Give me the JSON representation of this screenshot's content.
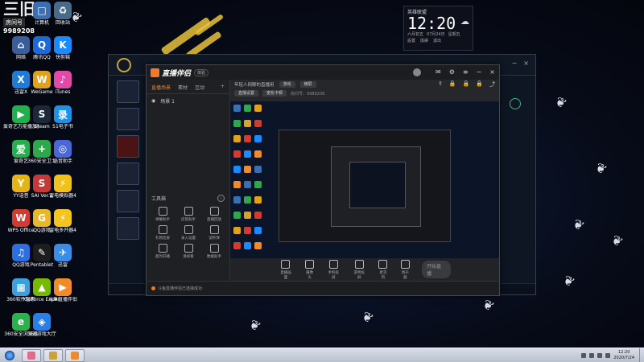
{
  "desktop": {
    "room_widget": {
      "big": "三旧",
      "label": "房间号",
      "number": "9989208"
    },
    "icons": [
      {
        "id": "computer",
        "label": "计算机",
        "color": "#3b6fb0",
        "glyph": "□"
      },
      {
        "id": "recycle",
        "label": "回收站",
        "color": "#4a6a8a",
        "glyph": "♻"
      },
      {
        "id": "network",
        "label": "网络",
        "color": "#3a5e9a",
        "glyph": "⌂"
      },
      {
        "id": "qq",
        "label": "腾讯QQ",
        "color": "#1a6bd8",
        "glyph": "Q"
      },
      {
        "id": "kuaitui",
        "label": "快剪辑",
        "color": "#1a8aff",
        "glyph": "K"
      },
      {
        "id": "xunlei",
        "label": "迅雷X",
        "color": "#1c7cd6",
        "glyph": "X"
      },
      {
        "id": "wegame",
        "label": "WeGame",
        "color": "#e0a21a",
        "glyph": "W"
      },
      {
        "id": "itunes",
        "label": "iTunes",
        "color": "#e24aa8",
        "glyph": "♪"
      },
      {
        "id": "aiqiyi",
        "label": "爱奇艺万能播放器",
        "color": "#21b04b",
        "glyph": "▶"
      },
      {
        "id": "steam",
        "label": "Steam",
        "color": "#1b2838",
        "glyph": "S"
      },
      {
        "id": "luyin",
        "label": "51电子书",
        "color": "#1e90e8",
        "glyph": "录"
      },
      {
        "id": "iqiyi",
        "label": "爱奇艺",
        "color": "#23b14d",
        "glyph": "爱"
      },
      {
        "id": "360",
        "label": "360安全卫士",
        "color": "#2ea84a",
        "glyph": "+"
      },
      {
        "id": "chat",
        "label": "语音助手",
        "color": "#4a67d8",
        "glyph": "◎"
      },
      {
        "id": "yy",
        "label": "YY语音",
        "color": "#e4b317",
        "glyph": "Y"
      },
      {
        "id": "sai",
        "label": "SAI Ver.2",
        "color": "#c23a3a",
        "glyph": "S"
      },
      {
        "id": "zbj4",
        "label": "雷电模拟器4",
        "color": "#f1c21b",
        "glyph": "⚡"
      },
      {
        "id": "wps",
        "label": "WPS Office",
        "color": "#d23b2e",
        "glyph": "W"
      },
      {
        "id": "qqgame",
        "label": "QQ游戏",
        "color": "#e9b82a",
        "glyph": "G"
      },
      {
        "id": "leidian",
        "label": "雷电多开器4",
        "color": "#f4c41f",
        "glyph": "⚡"
      },
      {
        "id": "qqmusic",
        "label": "QQ游戏",
        "color": "#2b6fe0",
        "glyph": "♫"
      },
      {
        "id": "pentablet",
        "label": "Pentablet",
        "color": "#1d1d1d",
        "glyph": "✎"
      },
      {
        "id": "feishu",
        "label": "迅雷",
        "color": "#3a8ce8",
        "glyph": "✈"
      },
      {
        "id": "360soft",
        "label": "360软件管家",
        "color": "#3aa0e0",
        "glyph": "▦"
      },
      {
        "id": "geforce",
        "label": "GeForce Experience",
        "color": "#76b900",
        "glyph": "▲"
      },
      {
        "id": "douyu",
        "label": "斗鱼直播伴侣",
        "color": "#f08a2a",
        "glyph": "▶"
      },
      {
        "id": "360browser",
        "label": "360安全浏览器",
        "color": "#2bb24c",
        "glyph": "e"
      },
      {
        "id": "360zip",
        "label": "360游戏大厅",
        "color": "#2a7ee4",
        "glyph": "◈"
      }
    ],
    "clock": {
      "location": "英雄联盟",
      "time": "12:20",
      "date_cn": "六月初五",
      "date": "07月24日",
      "weekday": "星期五",
      "foot": [
        "設置",
        "換膚",
        "退出"
      ]
    }
  },
  "app": {
    "logo_text": "直播伴侣",
    "version": "体验",
    "tabs": [
      "直播场景",
      "素材",
      "互动"
    ],
    "scene_name": "场景 1",
    "toolbox_label": "工具箱",
    "tools": [
      "弹幕助手",
      "房管助手",
      "直播回放",
      "礼物连屏",
      "录入设置",
      "读秒弹",
      "超时开播",
      "清屏看",
      "数据助手"
    ],
    "stream_title": "年轻人网聊的直播用",
    "category_pill": "游戏",
    "mode_pill": "横屏",
    "info_pills": [
      "直播设置",
      "宽松卡顿"
    ],
    "room_info": "房间号：9989208",
    "controls": [
      "直播画面",
      "摄像头",
      "手机投屏",
      "游戏投屏",
      "麦克风",
      "扬声器"
    ],
    "start_label": "开始直播",
    "status_text": "斗鱼直播伴侣已连接成功"
  },
  "taskbar": {
    "apps": [
      {
        "id": "browser",
        "color": "#e26a8a"
      },
      {
        "id": "lol",
        "color": "#c9a33a"
      },
      {
        "id": "douyu",
        "color": "#f08a2a"
      }
    ],
    "clock_time": "12:20",
    "clock_date": "2020/7/24"
  }
}
